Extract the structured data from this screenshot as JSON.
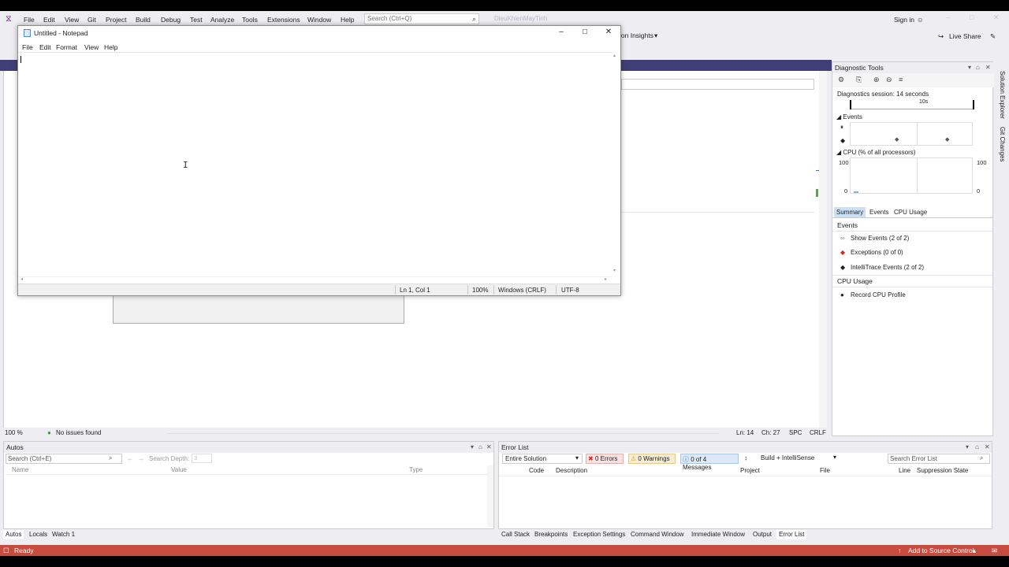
{
  "vs": {
    "menu": [
      "File",
      "Edit",
      "View",
      "Git",
      "Project",
      "Build",
      "Debug",
      "Test",
      "Analyze",
      "Tools",
      "Extensions",
      "Window",
      "Help"
    ],
    "search_placeholder": "Search (Ctrl+Q)",
    "solution_name": "DieuKhienMayTinh",
    "sign_in": "Sign in",
    "insights": "ion Insights",
    "live_share": "Live Share",
    "editor_status": {
      "zoom": "100 %",
      "issues": "No issues found",
      "ln": "Ln: 14",
      "ch": "Ch: 27",
      "spc": "SPC",
      "crlf": "CRLF"
    },
    "side_tabs": [
      "Solution Explorer",
      "Git Changes"
    ]
  },
  "diagnostic": {
    "title": "Diagnostic Tools",
    "session": "Diagnostics session: 14 seconds",
    "timeline_label": "10s",
    "events_header": "Events",
    "cpu_header": "CPU (% of all processors)",
    "cpu_max_left": "100",
    "cpu_min_left": "0",
    "cpu_max_right": "100",
    "cpu_min_right": "0",
    "tabs": [
      "Summary",
      "Events",
      "CPU Usage"
    ],
    "summary_events_title": "Events",
    "show_events": "Show Events (2 of 2)",
    "exceptions": "Exceptions (0 of 0)",
    "intellitrace": "IntelliTrace Events (2 of 2)",
    "cpu_usage_title": "CPU Usage",
    "record_cpu": "Record CPU Profile"
  },
  "autos": {
    "title": "Autos",
    "search_placeholder": "Search (Ctrl+E)",
    "search_depth_label": "Search Depth:",
    "search_depth_value": "3",
    "columns": [
      "Name",
      "Value",
      "Type"
    ],
    "tabs": [
      "Autos",
      "Locals",
      "Watch 1"
    ]
  },
  "errorlist": {
    "title": "Error List",
    "scope": "Entire Solution",
    "errors": "0 Errors",
    "warnings": "0 Warnings",
    "messages": "0 of 4 Messages",
    "build_filter": "Build + IntelliSense",
    "search_placeholder": "Search Error List",
    "columns": [
      "Code",
      "Description",
      "Project",
      "File",
      "Line",
      "Suppression State"
    ],
    "tabs": [
      "Call Stack",
      "Breakpoints",
      "Exception Settings",
      "Command Window",
      "Immediate Window",
      "Output",
      "Error List"
    ]
  },
  "statusbar": {
    "ready": "Ready",
    "source_control": "Add to Source Control"
  },
  "notepad": {
    "title": "Untitled - Notepad",
    "menu": [
      "File",
      "Edit",
      "Format",
      "View",
      "Help"
    ],
    "status_position": "Ln 1, Col 1",
    "status_zoom": "100%",
    "status_eol": "Windows (CRLF)",
    "status_encoding": "UTF-8"
  },
  "colors": {
    "vs_accent": "#68217a",
    "status_bar": "#c74b3e",
    "header_strip": "#3f3f75"
  }
}
